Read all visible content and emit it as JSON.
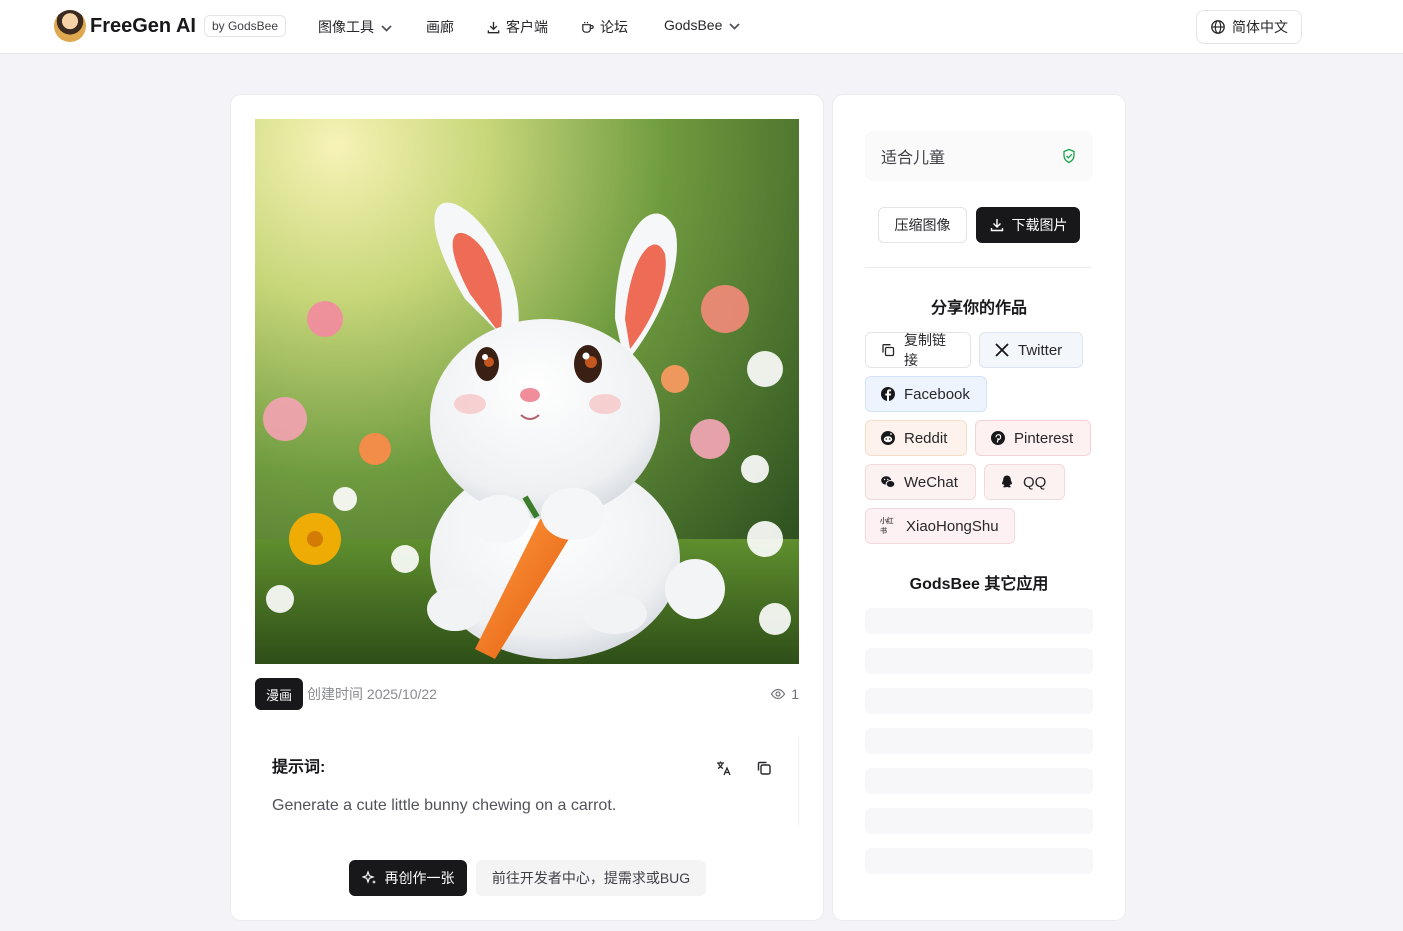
{
  "header": {
    "brand": "FreeGen AI",
    "by_badge": "by GodsBee",
    "nav": [
      {
        "label": "图像工具",
        "dropdown": true
      },
      {
        "label": "画廊"
      },
      {
        "label": "客户端",
        "icon": "download-icon"
      },
      {
        "label": "论坛",
        "icon": "cup-icon"
      },
      {
        "label": "GodsBee",
        "dropdown": true
      }
    ],
    "language": "简体中文"
  },
  "artwork": {
    "tag": "漫画",
    "created": "创建时间 2025/10/22",
    "views": "1",
    "prompt_title": "提示词:",
    "prompt_text": "Generate a cute little bunny chewing on a carrot.",
    "recreate_label": "再创作一张",
    "dev_center_label": "前往开发者中心，提需求或BUG"
  },
  "sidebar": {
    "kid_safe_label": "适合儿童",
    "compress_label": "压缩图像",
    "download_label": "下载图片",
    "share_title": "分享你的作品",
    "share": {
      "copy_link": "复制链接",
      "twitter": "Twitter",
      "facebook": "Facebook",
      "reddit": "Reddit",
      "pinterest": "Pinterest",
      "wechat": "WeChat",
      "qq": "QQ",
      "xiaohongshu": "XiaoHongShu",
      "xiaohongshu_logo": "小红书"
    },
    "other_apps_title": "GodsBee 其它应用"
  },
  "colors": {
    "primary": "#18181b",
    "page_bg": "#f4f4f8",
    "safe_green": "#16a34a"
  }
}
